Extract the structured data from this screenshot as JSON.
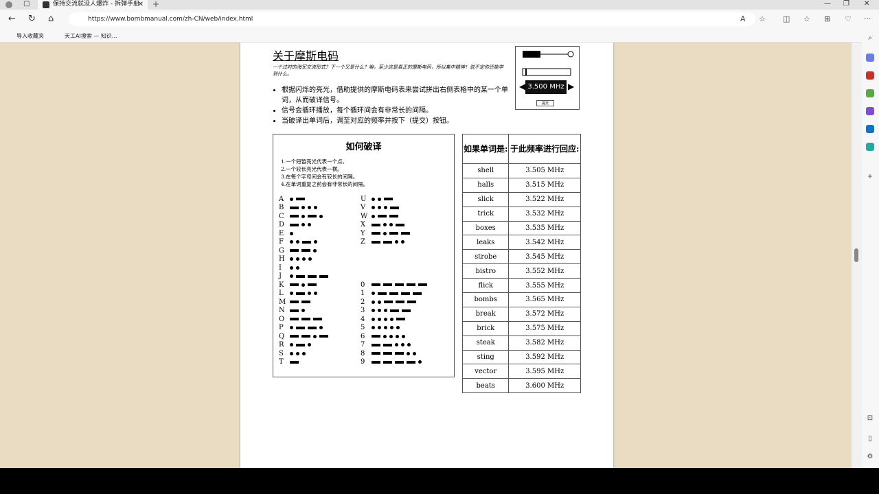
{
  "browser": {
    "tab_title": "保持交流就没人爆炸 - 拆弹手册",
    "url": "https://www.bombmanual.com/zh-CN/web/index.html",
    "bookmarks": [
      "导入收藏夹",
      "天工AI搜索 — 知识..."
    ]
  },
  "page": {
    "title": "关于摩斯电码",
    "intro": "一个过时的海军交流形式？下一个又是什么？嘛，至少这是真正的摩斯电码，所以集中精神！说不定你还能学到什么。",
    "bullets": [
      "根据闪烁的亮光，借助提供的摩斯电码表来尝试拼出右侧表格中的某一个单词，从而破译信号。",
      "信号会循环播放，每个循环间会有非常长的间隔。",
      "当破译出单词后，调至对应的频率并按下（提交）按钮。"
    ],
    "module": {
      "frequency": "3.500 MHz",
      "submit": "提交"
    },
    "how": {
      "title": "如何破译",
      "rules": [
        "1.一个短暂亮光代表一个点。",
        "2.一个较长亮光代表一横。",
        "3.在每个字母间会有较长的间隔。",
        "4.在单词重复之前会有非常长的间隔。"
      ]
    },
    "morse_letters": [
      [
        "A",
        ".-"
      ],
      [
        "B",
        "-..."
      ],
      [
        "C",
        "-.-."
      ],
      [
        "D",
        "-.."
      ],
      [
        "E",
        "."
      ],
      [
        "F",
        "..-."
      ],
      [
        "G",
        "--."
      ],
      [
        "H",
        "...."
      ],
      [
        "I",
        ".."
      ],
      [
        "J",
        ".---"
      ],
      [
        "K",
        "-.-"
      ],
      [
        "L",
        ".-.."
      ],
      [
        "M",
        "--"
      ],
      [
        "N",
        "-."
      ],
      [
        "O",
        "---"
      ],
      [
        "P",
        ".--."
      ],
      [
        "Q",
        "--.-"
      ],
      [
        "R",
        ".-."
      ],
      [
        "S",
        "..."
      ],
      [
        "T",
        "-"
      ]
    ],
    "morse_letters2": [
      [
        "U",
        "..-"
      ],
      [
        "V",
        "...-"
      ],
      [
        "W",
        ".--"
      ],
      [
        "X",
        "-..-"
      ],
      [
        "Y",
        "-.--"
      ],
      [
        "Z",
        "--.."
      ]
    ],
    "morse_digits": [
      [
        "0",
        "-----"
      ],
      [
        "1",
        ".----"
      ],
      [
        "2",
        "..---"
      ],
      [
        "3",
        "...--"
      ],
      [
        "4",
        "....-"
      ],
      [
        "5",
        "....."
      ],
      [
        "6",
        "-...."
      ],
      [
        "7",
        "--..."
      ],
      [
        "8",
        "---.."
      ],
      [
        "9",
        "----."
      ]
    ],
    "table": {
      "headers": [
        "如果单词是:",
        "于此频率进行回应:"
      ],
      "rows": [
        [
          "shell",
          "3.505 MHz"
        ],
        [
          "halls",
          "3.515 MHz"
        ],
        [
          "slick",
          "3.522 MHz"
        ],
        [
          "trick",
          "3.532 MHz"
        ],
        [
          "boxes",
          "3.535 MHz"
        ],
        [
          "leaks",
          "3.542 MHz"
        ],
        [
          "strobe",
          "3.545 MHz"
        ],
        [
          "bistro",
          "3.552 MHz"
        ],
        [
          "flick",
          "3.555 MHz"
        ],
        [
          "bombs",
          "3.565 MHz"
        ],
        [
          "break",
          "3.572 MHz"
        ],
        [
          "brick",
          "3.575 MHz"
        ],
        [
          "steak",
          "3.582 MHz"
        ],
        [
          "sting",
          "3.592 MHz"
        ],
        [
          "vector",
          "3.595 MHz"
        ],
        [
          "beats",
          "3.600 MHz"
        ]
      ]
    }
  }
}
